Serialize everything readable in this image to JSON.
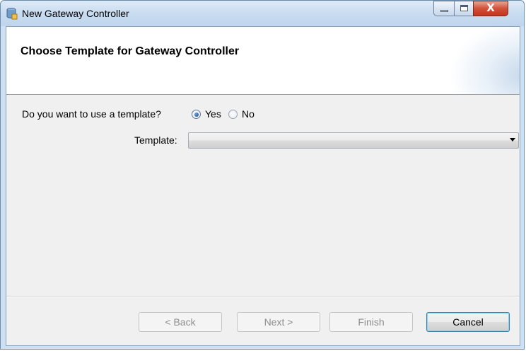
{
  "window": {
    "title": "New Gateway Controller",
    "controls": {
      "minimize": "—",
      "maximize": "□",
      "close": "X"
    }
  },
  "header": {
    "title": "Choose Template for Gateway Controller"
  },
  "form": {
    "question": "Do you want to use a template?",
    "options": [
      {
        "label": "Yes",
        "checked": true
      },
      {
        "label": "No",
        "checked": false
      }
    ],
    "template_label": "Template:",
    "template_value": ""
  },
  "buttons": {
    "back": "< Back",
    "next": "Next >",
    "finish": "Finish",
    "cancel": "Cancel"
  },
  "colors": {
    "title_bar": "#c9dcf0",
    "client_bg": "#f0f0f0",
    "close_red": "#c4331d"
  },
  "icons": {
    "app": "gateway-database-icon",
    "dropdown": "chevron-down-icon"
  }
}
